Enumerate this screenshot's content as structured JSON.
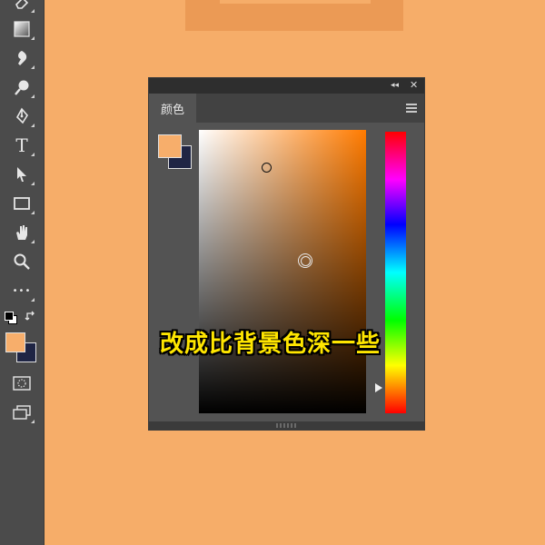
{
  "colors": {
    "canvas": "#f6ad69",
    "art_block": "#eb9a55",
    "foreground": "#f7ae6b",
    "background": "#1f2544",
    "picker_hue": "#ff7b00"
  },
  "toolbar": {
    "tools": [
      {
        "icon": "eraser-icon"
      },
      {
        "icon": "gradient-icon"
      },
      {
        "icon": "blur-icon"
      },
      {
        "icon": "dodge-icon"
      },
      {
        "icon": "pen-icon"
      },
      {
        "icon": "type-icon",
        "label": "T"
      },
      {
        "icon": "path-selection-icon"
      },
      {
        "icon": "rectangle-icon"
      },
      {
        "icon": "hand-icon"
      },
      {
        "icon": "zoom-icon"
      },
      {
        "icon": "more-tools-icon",
        "label": "•••"
      },
      {
        "icon": "quick-mask-icon"
      },
      {
        "icon": "screen-mode-icon"
      }
    ]
  },
  "panel": {
    "title": "颜色",
    "collapse_label": "◂◂",
    "close_label": "✕",
    "hue_marker_position": 0.91
  },
  "caption": {
    "text": "改成比背景色深一些"
  }
}
